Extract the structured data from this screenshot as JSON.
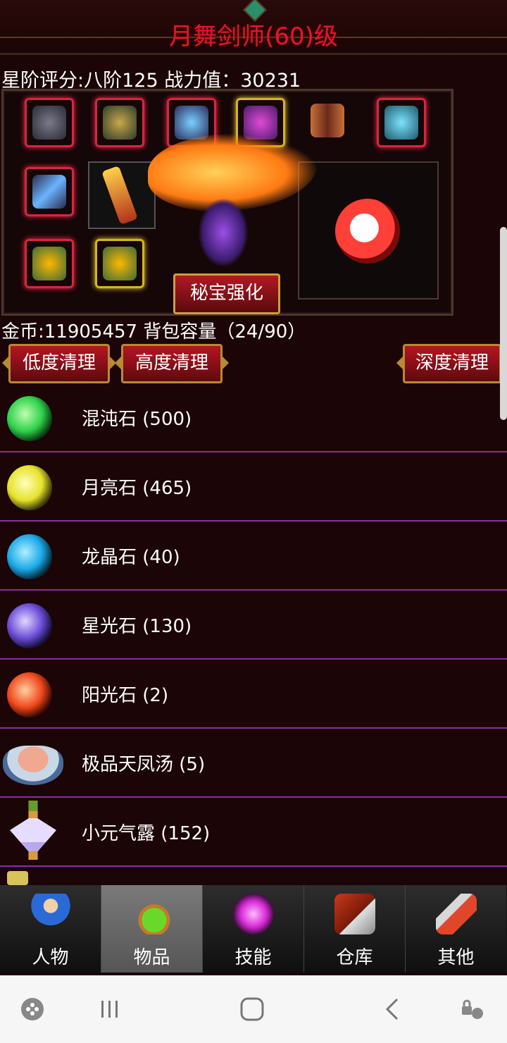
{
  "header": {
    "title": "月舞剑师(60)级"
  },
  "rating_text": "星阶评分:八阶125 战力值：30231",
  "secret_button_label": "秘宝强化",
  "gold_text": "金币:11905457 背包容量（24/90）",
  "clean_buttons": [
    "低度清理",
    "高度清理",
    "深度清理"
  ],
  "items": [
    {
      "name": "混沌石 (500)",
      "icon": "green-orb-icon",
      "color": "#2fd14a"
    },
    {
      "name": "月亮石 (465)",
      "icon": "yellow-orb-icon",
      "color": "#e6e22b"
    },
    {
      "name": "龙晶石 (40)",
      "icon": "blue-orb-icon",
      "color": "#1aa8e8"
    },
    {
      "name": "星光石 (130)",
      "icon": "purple-orb-icon",
      "color": "#6a4bd6"
    },
    {
      "name": "阳光石 (2)",
      "icon": "red-orb-icon",
      "color": "#f0461a"
    },
    {
      "name": "极品天凤汤 (5)",
      "icon": "soup-bowl-icon",
      "color": "#c9d8e6"
    },
    {
      "name": "小元气露 (152)",
      "icon": "diamond-bottle-icon",
      "color": "#b9a8f0"
    }
  ],
  "nav_tabs": [
    {
      "label": "人物",
      "icon": "character-icon"
    },
    {
      "label": "物品",
      "icon": "potion-icon"
    },
    {
      "label": "技能",
      "icon": "skill-icon"
    },
    {
      "label": "仓库",
      "icon": "warehouse-icon"
    },
    {
      "label": "其他",
      "icon": "other-icon"
    }
  ],
  "active_tab": "物品"
}
